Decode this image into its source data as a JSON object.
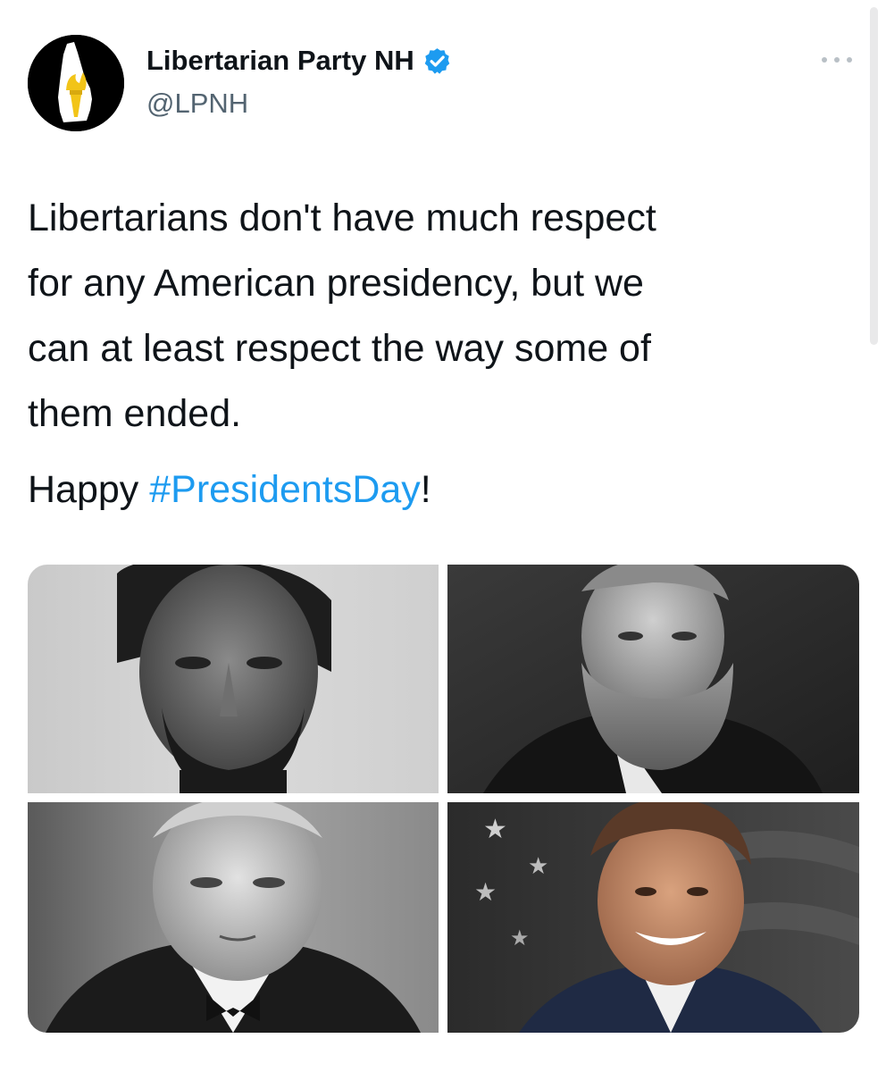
{
  "account": {
    "display_name": "Libertarian Party NH",
    "handle": "@LPNH",
    "verified": true,
    "avatar_icon": "lpnh-torch-logo-icon"
  },
  "tweet": {
    "text_lines": [
      "Libertarians don't have much respect",
      "for any American presidency, but we",
      "can at least respect the way some of",
      "them ended."
    ],
    "second_prefix": "Happy ",
    "hashtag": "#PresidentsDay",
    "second_suffix": "!"
  },
  "media": {
    "count": 4,
    "photos": [
      "portrait-photo",
      "portrait-photo",
      "portrait-photo",
      "portrait-photo"
    ]
  },
  "colors": {
    "hashtag": "#1d9bf0",
    "verified_badge": "#1d9bf0",
    "secondary_text": "#536471"
  },
  "icons": {
    "more": "more-options-icon",
    "verified": "verified-badge-icon"
  }
}
